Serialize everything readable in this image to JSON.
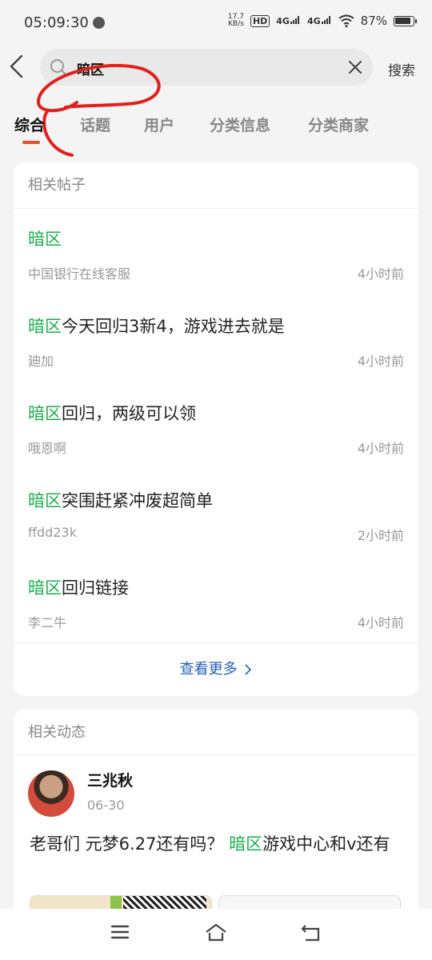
{
  "status_bar": {
    "time": "05:09:30",
    "speed_value": "17.7",
    "speed_unit": "KB/s",
    "hd_label": "HD",
    "net1": "4G",
    "net2": "4G",
    "battery": "87%"
  },
  "search": {
    "query": "暗区",
    "button_label": "搜索"
  },
  "tabs": [
    "综合",
    "话题",
    "用户",
    "分类信息",
    "分类商家"
  ],
  "related_posts": {
    "title": "相关帖子",
    "items": [
      {
        "highlight": "暗区",
        "rest": "",
        "author": "中国银行在线客服",
        "time": "4小时前"
      },
      {
        "highlight": "暗区",
        "rest": "今天回归3新4，游戏进去就是",
        "author": "廸加",
        "time": "4小时前"
      },
      {
        "highlight": "暗区",
        "rest": "回归，两级可以领",
        "author": "哦恩啊",
        "time": "4小时前"
      },
      {
        "highlight": "暗区",
        "rest": "突围赶紧冲废超简单",
        "author": "ffdd23k",
        "time": "2小时前"
      },
      {
        "highlight": "暗区",
        "rest": "回归链接",
        "author": "李二牛",
        "time": "4小时前"
      }
    ],
    "more_label": "查看更多"
  },
  "related_feed": {
    "title": "相关动态",
    "user_name": "三兆秋",
    "date": "06-30",
    "text_before": "老哥们 元梦6.27还有吗？ ",
    "text_highlight": "暗区",
    "text_after": "游戏中心和v还有"
  },
  "colors": {
    "highlight": "#1aae4b",
    "tab_indicator": "#ef4b2a",
    "link": "#2360b4",
    "annotation": "#e0201d"
  },
  "icons": {
    "back": "chevron-left-icon",
    "search": "search-icon",
    "clear": "close-icon",
    "more": "chevron-right-icon",
    "nav_menu": "menu-icon",
    "nav_home": "home-icon",
    "nav_back": "return-icon"
  }
}
